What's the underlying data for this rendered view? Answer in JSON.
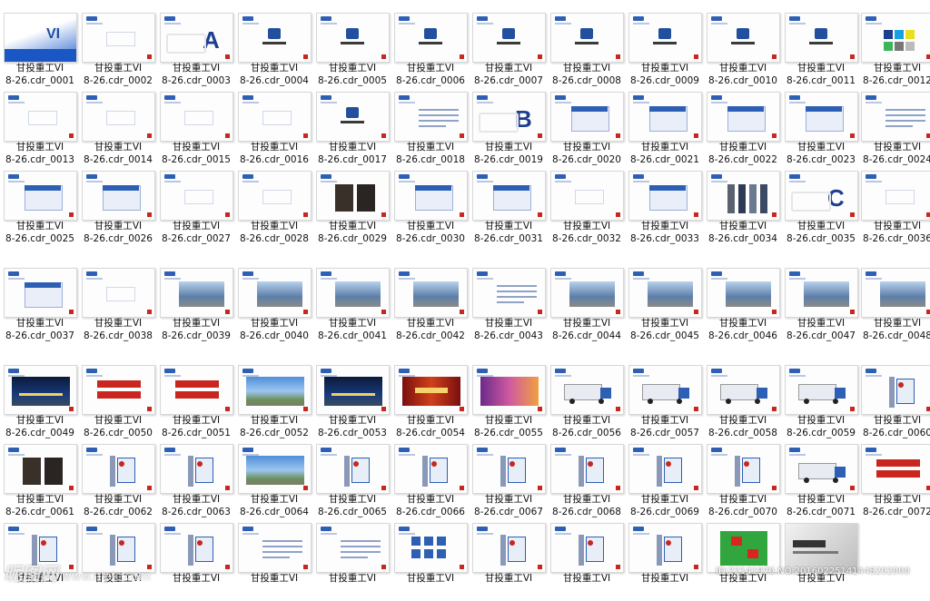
{
  "caption_prefix": "甘投重工VI",
  "items": [
    {
      "l2": "8-26.cdr_0001",
      "t": "cover"
    },
    {
      "l2": "8-26.cdr_0002",
      "t": "plain"
    },
    {
      "l2": "8-26.cdr_0003",
      "t": "letter",
      "letter": "A"
    },
    {
      "l2": "8-26.cdr_0004",
      "t": "logo"
    },
    {
      "l2": "8-26.cdr_0005",
      "t": "logo"
    },
    {
      "l2": "8-26.cdr_0006",
      "t": "logo"
    },
    {
      "l2": "8-26.cdr_0007",
      "t": "logo"
    },
    {
      "l2": "8-26.cdr_0008",
      "t": "logo"
    },
    {
      "l2": "8-26.cdr_0009",
      "t": "logo"
    },
    {
      "l2": "8-26.cdr_0010",
      "t": "logo"
    },
    {
      "l2": "8-26.cdr_0011",
      "t": "logo"
    },
    {
      "l2": "8-26.cdr_0012",
      "t": "colors"
    },
    {
      "l2": "8-26.cdr_0013",
      "t": "plain"
    },
    {
      "l2": "8-26.cdr_0014",
      "t": "plain"
    },
    {
      "l2": "8-26.cdr_0015",
      "t": "plain"
    },
    {
      "l2": "8-26.cdr_0016",
      "t": "plain"
    },
    {
      "l2": "8-26.cdr_0017",
      "t": "logo"
    },
    {
      "l2": "8-26.cdr_0018",
      "t": "lines"
    },
    {
      "l2": "8-26.cdr_0019",
      "t": "letter",
      "letter": "B"
    },
    {
      "l2": "8-26.cdr_0020",
      "t": "card"
    },
    {
      "l2": "8-26.cdr_0021",
      "t": "card"
    },
    {
      "l2": "8-26.cdr_0022",
      "t": "card"
    },
    {
      "l2": "8-26.cdr_0023",
      "t": "card"
    },
    {
      "l2": "8-26.cdr_0024",
      "t": "lines"
    },
    {
      "l2": "8-26.cdr_0025",
      "t": "card"
    },
    {
      "l2": "8-26.cdr_0026",
      "t": "card"
    },
    {
      "l2": "8-26.cdr_0027",
      "t": "plain"
    },
    {
      "l2": "8-26.cdr_0028",
      "t": "plain"
    },
    {
      "l2": "8-26.cdr_0029",
      "t": "dark"
    },
    {
      "l2": "8-26.cdr_0030",
      "t": "card"
    },
    {
      "l2": "8-26.cdr_0031",
      "t": "card"
    },
    {
      "l2": "8-26.cdr_0032",
      "t": "plain"
    },
    {
      "l2": "8-26.cdr_0033",
      "t": "card"
    },
    {
      "l2": "8-26.cdr_0034",
      "t": "people"
    },
    {
      "l2": "8-26.cdr_0035",
      "t": "letter",
      "letter": "C"
    },
    {
      "l2": "8-26.cdr_0036",
      "t": "plain"
    },
    {
      "l2": "8-26.cdr_0037",
      "t": "card"
    },
    {
      "l2": "8-26.cdr_0038",
      "t": "plain"
    },
    {
      "l2": "8-26.cdr_0039",
      "t": "photo"
    },
    {
      "l2": "8-26.cdr_0040",
      "t": "photo"
    },
    {
      "l2": "8-26.cdr_0041",
      "t": "photo"
    },
    {
      "l2": "8-26.cdr_0042",
      "t": "photo"
    },
    {
      "l2": "8-26.cdr_0043",
      "t": "lines"
    },
    {
      "l2": "8-26.cdr_0044",
      "t": "photo"
    },
    {
      "l2": "8-26.cdr_0045",
      "t": "photo"
    },
    {
      "l2": "8-26.cdr_0046",
      "t": "photo"
    },
    {
      "l2": "8-26.cdr_0047",
      "t": "photo"
    },
    {
      "l2": "8-26.cdr_0048",
      "t": "photo"
    },
    {
      "l2": "8-26.cdr_0049",
      "t": "night"
    },
    {
      "l2": "8-26.cdr_0050",
      "t": "red"
    },
    {
      "l2": "8-26.cdr_0051",
      "t": "red"
    },
    {
      "l2": "8-26.cdr_0052",
      "t": "sky"
    },
    {
      "l2": "8-26.cdr_0053",
      "t": "night"
    },
    {
      "l2": "8-26.cdr_0054",
      "t": "banner"
    },
    {
      "l2": "8-26.cdr_0055",
      "t": "banner2"
    },
    {
      "l2": "8-26.cdr_0056",
      "t": "truck"
    },
    {
      "l2": "8-26.cdr_0057",
      "t": "truck"
    },
    {
      "l2": "8-26.cdr_0058",
      "t": "truck"
    },
    {
      "l2": "8-26.cdr_0059",
      "t": "truck"
    },
    {
      "l2": "8-26.cdr_0060",
      "t": "sign"
    },
    {
      "l2": "8-26.cdr_0061",
      "t": "dark"
    },
    {
      "l2": "8-26.cdr_0062",
      "t": "sign"
    },
    {
      "l2": "8-26.cdr_0063",
      "t": "sign"
    },
    {
      "l2": "8-26.cdr_0064",
      "t": "sky"
    },
    {
      "l2": "8-26.cdr_0065",
      "t": "sign"
    },
    {
      "l2": "8-26.cdr_0066",
      "t": "sign"
    },
    {
      "l2": "8-26.cdr_0067",
      "t": "sign"
    },
    {
      "l2": "8-26.cdr_0068",
      "t": "sign"
    },
    {
      "l2": "8-26.cdr_0069",
      "t": "sign"
    },
    {
      "l2": "8-26.cdr_0070",
      "t": "sign"
    },
    {
      "l2": "8-26.cdr_0071",
      "t": "truck"
    },
    {
      "l2": "8-26.cdr_0072",
      "t": "red"
    },
    {
      "l2": "",
      "t": "sign"
    },
    {
      "l2": "",
      "t": "sign"
    },
    {
      "l2": "",
      "t": "sign"
    },
    {
      "l2": "",
      "t": "lines"
    },
    {
      "l2": "",
      "t": "lines"
    },
    {
      "l2": "",
      "t": "icons"
    },
    {
      "l2": "",
      "t": "sign"
    },
    {
      "l2": "",
      "t": "sign"
    },
    {
      "l2": "",
      "t": "sign"
    },
    {
      "l2": "",
      "t": "greenred"
    },
    {
      "l2": "",
      "t": "cover2"
    }
  ],
  "watermark": {
    "brand": "昵图网",
    "url": "www.nipic.com"
  },
  "id_line": "ID:22141970 NO:20160225141448202000"
}
